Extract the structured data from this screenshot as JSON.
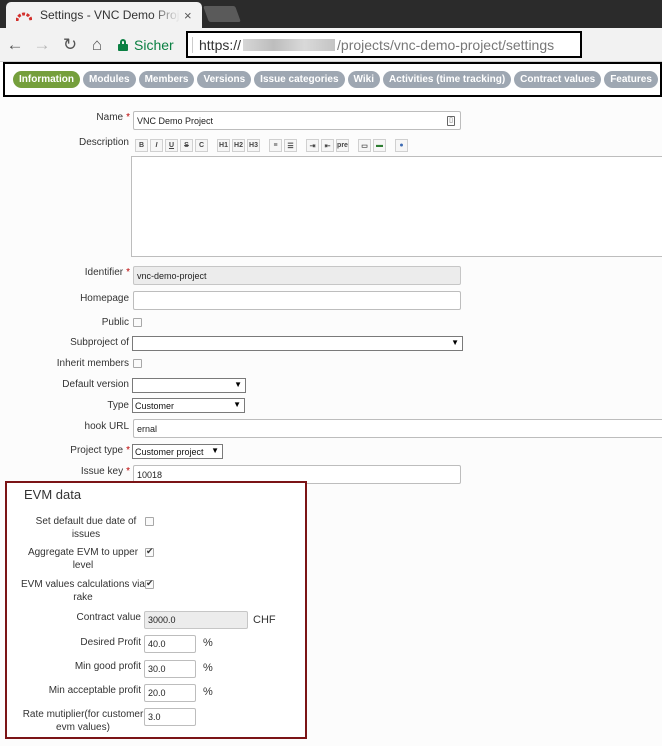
{
  "browser": {
    "tab_title": "Settings - VNC Demo Project",
    "close_glyph": "×",
    "secure_label": "Sicher",
    "url_scheme": "https://",
    "url_path": "/projects/vnc-demo-project/settings"
  },
  "project_tabs": [
    {
      "label": "Information",
      "active": true
    },
    {
      "label": "Modules"
    },
    {
      "label": "Members"
    },
    {
      "label": "Versions"
    },
    {
      "label": "Issue categories"
    },
    {
      "label": "Wiki"
    },
    {
      "label": "Activities (time tracking)"
    },
    {
      "label": "Contract values"
    },
    {
      "label": "Features"
    }
  ],
  "form": {
    "name_label": "Name",
    "name_value": "VNC Demo Project",
    "description_label": "Description",
    "identifier_label": "Identifier",
    "identifier_value": "vnc-demo-project",
    "homepage_label": "Homepage",
    "homepage_value": "",
    "public_label": "Public",
    "public_checked": false,
    "subproject_label": "Subproject of",
    "subproject_value": "",
    "inherit_label": "Inherit members",
    "inherit_checked": false,
    "default_version_label": "Default version",
    "default_version_value": "",
    "type_label": "Type",
    "type_value": "Customer",
    "hook_label": "hook URL",
    "hook_value": "ernal",
    "project_type_label": "Project type",
    "project_type_value": "Customer project",
    "issue_key_label": "Issue key",
    "issue_key_value": "10018",
    "required_mark": "*"
  },
  "wiki_toolbar": [
    "B",
    "I",
    "U",
    "S",
    "C",
    "H1",
    "H2",
    "H3",
    "ul",
    "ol",
    "»",
    "«",
    "pre",
    "lnk",
    "img",
    "?"
  ],
  "evm": {
    "title": "EVM data",
    "due_date_label": "Set default due date of issues",
    "due_date_checked": false,
    "aggregate_label": "Aggregate EVM to upper level",
    "aggregate_checked": true,
    "rake_label": "EVM values calculations via rake",
    "rake_checked": true,
    "contract_label": "Contract value",
    "contract_value": "3000.0",
    "contract_unit": "CHF",
    "desired_label": "Desired Profit",
    "desired_value": "40.0",
    "min_good_label": "Min good profit",
    "min_good_value": "30.0",
    "min_acc_label": "Min acceptable profit",
    "min_acc_value": "20.0",
    "percent": "%",
    "rate_label": "Rate mutiplier(for customer evm values)",
    "rate_value": "3.0"
  },
  "colors": {
    "tab_active": "#759f3c",
    "tab_inactive": "#9ea7b2",
    "required": "#bb0000",
    "evm_border": "#7b1416",
    "secure": "#0b8043"
  }
}
